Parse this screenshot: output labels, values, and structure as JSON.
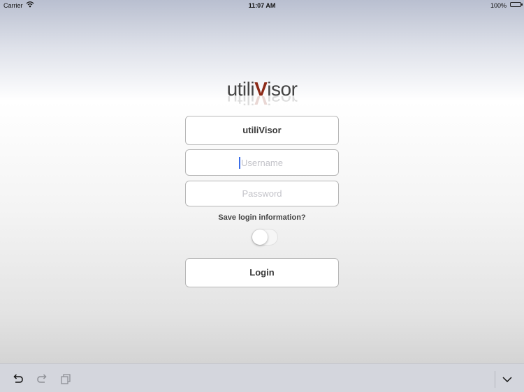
{
  "status_bar": {
    "carrier": "Carrier",
    "time": "11:07 AM",
    "battery": "100%"
  },
  "logo": {
    "prefix": "utili",
    "accent": "V",
    "suffix": "isor"
  },
  "form": {
    "company": "utiliVisor",
    "username_placeholder": "Username",
    "username_value": "",
    "password_placeholder": "Password",
    "password_value": "",
    "save_login_label": "Save login information?",
    "save_login_enabled": false,
    "login_label": "Login"
  },
  "keyboard_toolbar": {
    "icons": [
      "undo-icon",
      "redo-icon",
      "paste-icon",
      "dismiss-keyboard-icon"
    ]
  },
  "colors": {
    "logo_accent": "#8c2a18",
    "caret": "#3b6ee8"
  }
}
